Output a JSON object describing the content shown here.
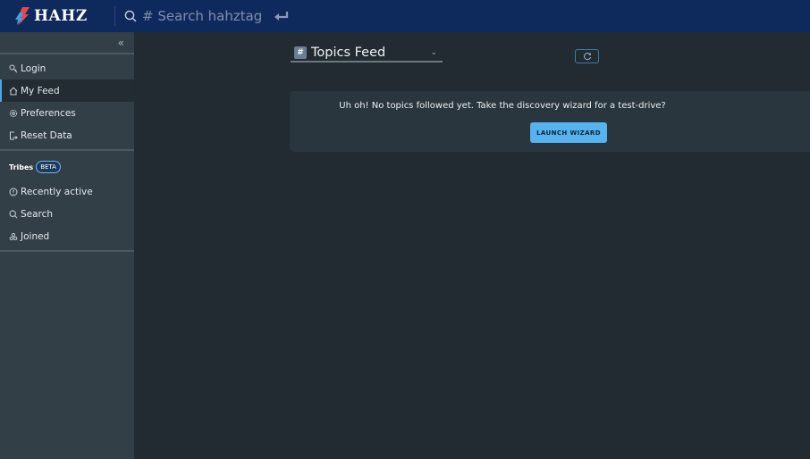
{
  "app": {
    "brand_name": "HAHZ",
    "search": {
      "placeholder": "# Search hahztag",
      "value": ""
    }
  },
  "sidebar": {
    "collapse_glyph": "«",
    "items": [
      {
        "label": "Login",
        "icon": "key-icon"
      },
      {
        "label": "My Feed",
        "icon": "home-icon",
        "active": true
      },
      {
        "label": "Preferences",
        "icon": "gear-icon"
      },
      {
        "label": "Reset Data",
        "icon": "logout-icon"
      }
    ],
    "tribes": {
      "label": "Tribes",
      "badge": "BETA",
      "items": [
        {
          "label": "Recently active",
          "icon": "alert-icon"
        },
        {
          "label": "Search",
          "icon": "search-icon"
        },
        {
          "label": "Joined",
          "icon": "group-icon"
        }
      ]
    }
  },
  "main": {
    "feed_selector": {
      "hash": "#",
      "value": "Topics Feed",
      "chevron": "⌄"
    },
    "empty_state": {
      "message": "Uh oh! No topics followed yet. Take the discovery wizard for a test-drive?",
      "button_label": "LAUNCH WIZARD"
    }
  },
  "colors": {
    "topbar": "#0e2a5c",
    "sidebar": "#333f47",
    "main_bg": "#212b31",
    "accent": "#56b3f0",
    "brand_red": "#e8474b",
    "brand_blue": "#3aa4dd"
  }
}
